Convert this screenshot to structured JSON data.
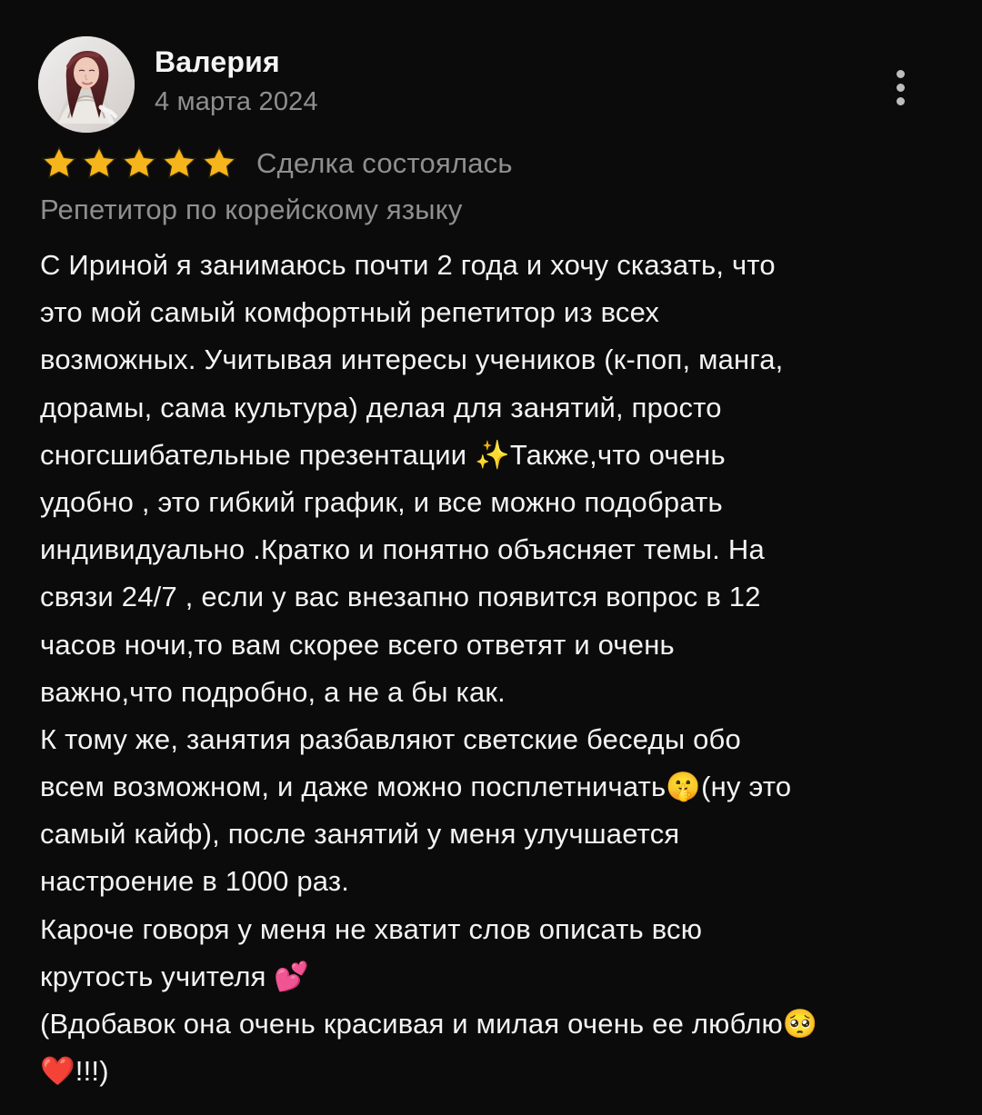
{
  "review": {
    "author_name": "Валерия",
    "date": "4 марта 2024",
    "status": "Сделка состоялась",
    "service": "Репетитор по корейскому языку",
    "rating": 5,
    "body_lines": [
      "С Ириной я занимаюсь почти 2 года и хочу сказать, что",
      "это мой самый комфортный репетитор из всех",
      "возможных. Учитывая интересы учеников (к-поп, манга,",
      "дорамы, сама культура) делая для занятий, просто",
      "сногсшибательные презентации ✨Также,что очень",
      "удобно , это гибкий график, и все можно подобрать",
      "индивидуально .Кратко и понятно объясняет темы. На",
      "связи 24/7 , если у вас внезапно появится вопрос в 12",
      "часов ночи,то вам скорее всего ответят и очень",
      "важно,что подробно, а не а бы как.",
      "К тому же, занятия разбавляют светские беседы обо",
      "всем возможном, и даже можно посплетничать🤫(ну это",
      "самый кайф), после занятий у меня улучшается",
      "настроение в 1000 раз.",
      "Кароче говоря  у меня не хватит слов описать всю",
      "крутость  учителя 💕",
      "(Вдобавок она очень красивая и милая очень ее люблю🥺",
      "❤️!!!)"
    ]
  },
  "colors": {
    "background": "#0b0b0b",
    "primary_text": "#f3f3f3",
    "secondary_text": "#8f8f8f",
    "star": "#f6b51a",
    "menu_dots": "#bdbdbd"
  },
  "icons": {
    "more": "more-vertical-icon",
    "star": "star-icon"
  }
}
